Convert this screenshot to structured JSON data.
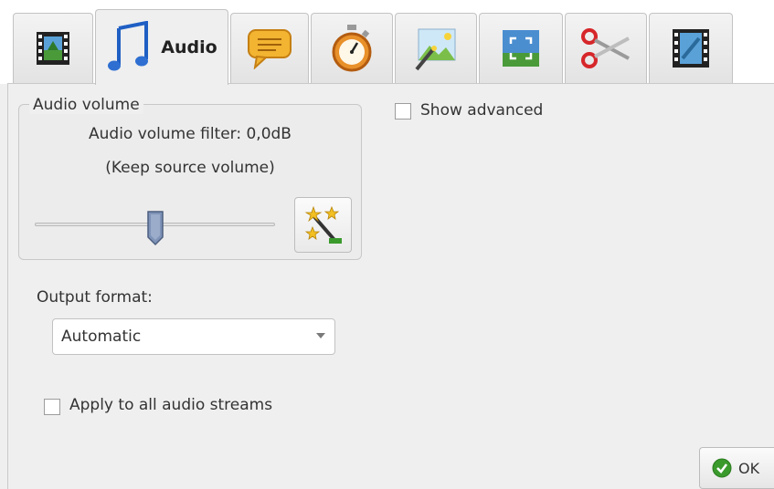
{
  "tabs": [
    {
      "id": "video",
      "icon": "film-icon",
      "label": ""
    },
    {
      "id": "audio",
      "icon": "music-note-icon",
      "label": "Audio",
      "active": true
    },
    {
      "id": "subtitles",
      "icon": "speech-bubble-icon",
      "label": ""
    },
    {
      "id": "timing",
      "icon": "stopwatch-icon",
      "label": ""
    },
    {
      "id": "effects",
      "icon": "picture-wand-icon",
      "label": ""
    },
    {
      "id": "crop",
      "icon": "crop-frame-icon",
      "label": ""
    },
    {
      "id": "cut",
      "icon": "scissors-icon",
      "label": ""
    },
    {
      "id": "merge",
      "icon": "film-link-icon",
      "label": ""
    }
  ],
  "audio_volume": {
    "group_title": "Audio volume",
    "filter_text": "Audio volume filter: 0,0dB",
    "status_text": "(Keep source volume)",
    "slider_value_fraction": 0.5,
    "auto_button_icon": "magic-wand-stars-icon"
  },
  "show_advanced": {
    "label": "Show advanced",
    "checked": false
  },
  "output_format": {
    "label": "Output format:",
    "selected": "Automatic"
  },
  "apply_all": {
    "label": "Apply to all audio streams",
    "checked": false
  },
  "ok_button": {
    "label": "OK",
    "icon": "check-circle-icon"
  },
  "colors": {
    "accent_green": "#3a9a2c",
    "tab_active_note": "#2f6fd1"
  }
}
